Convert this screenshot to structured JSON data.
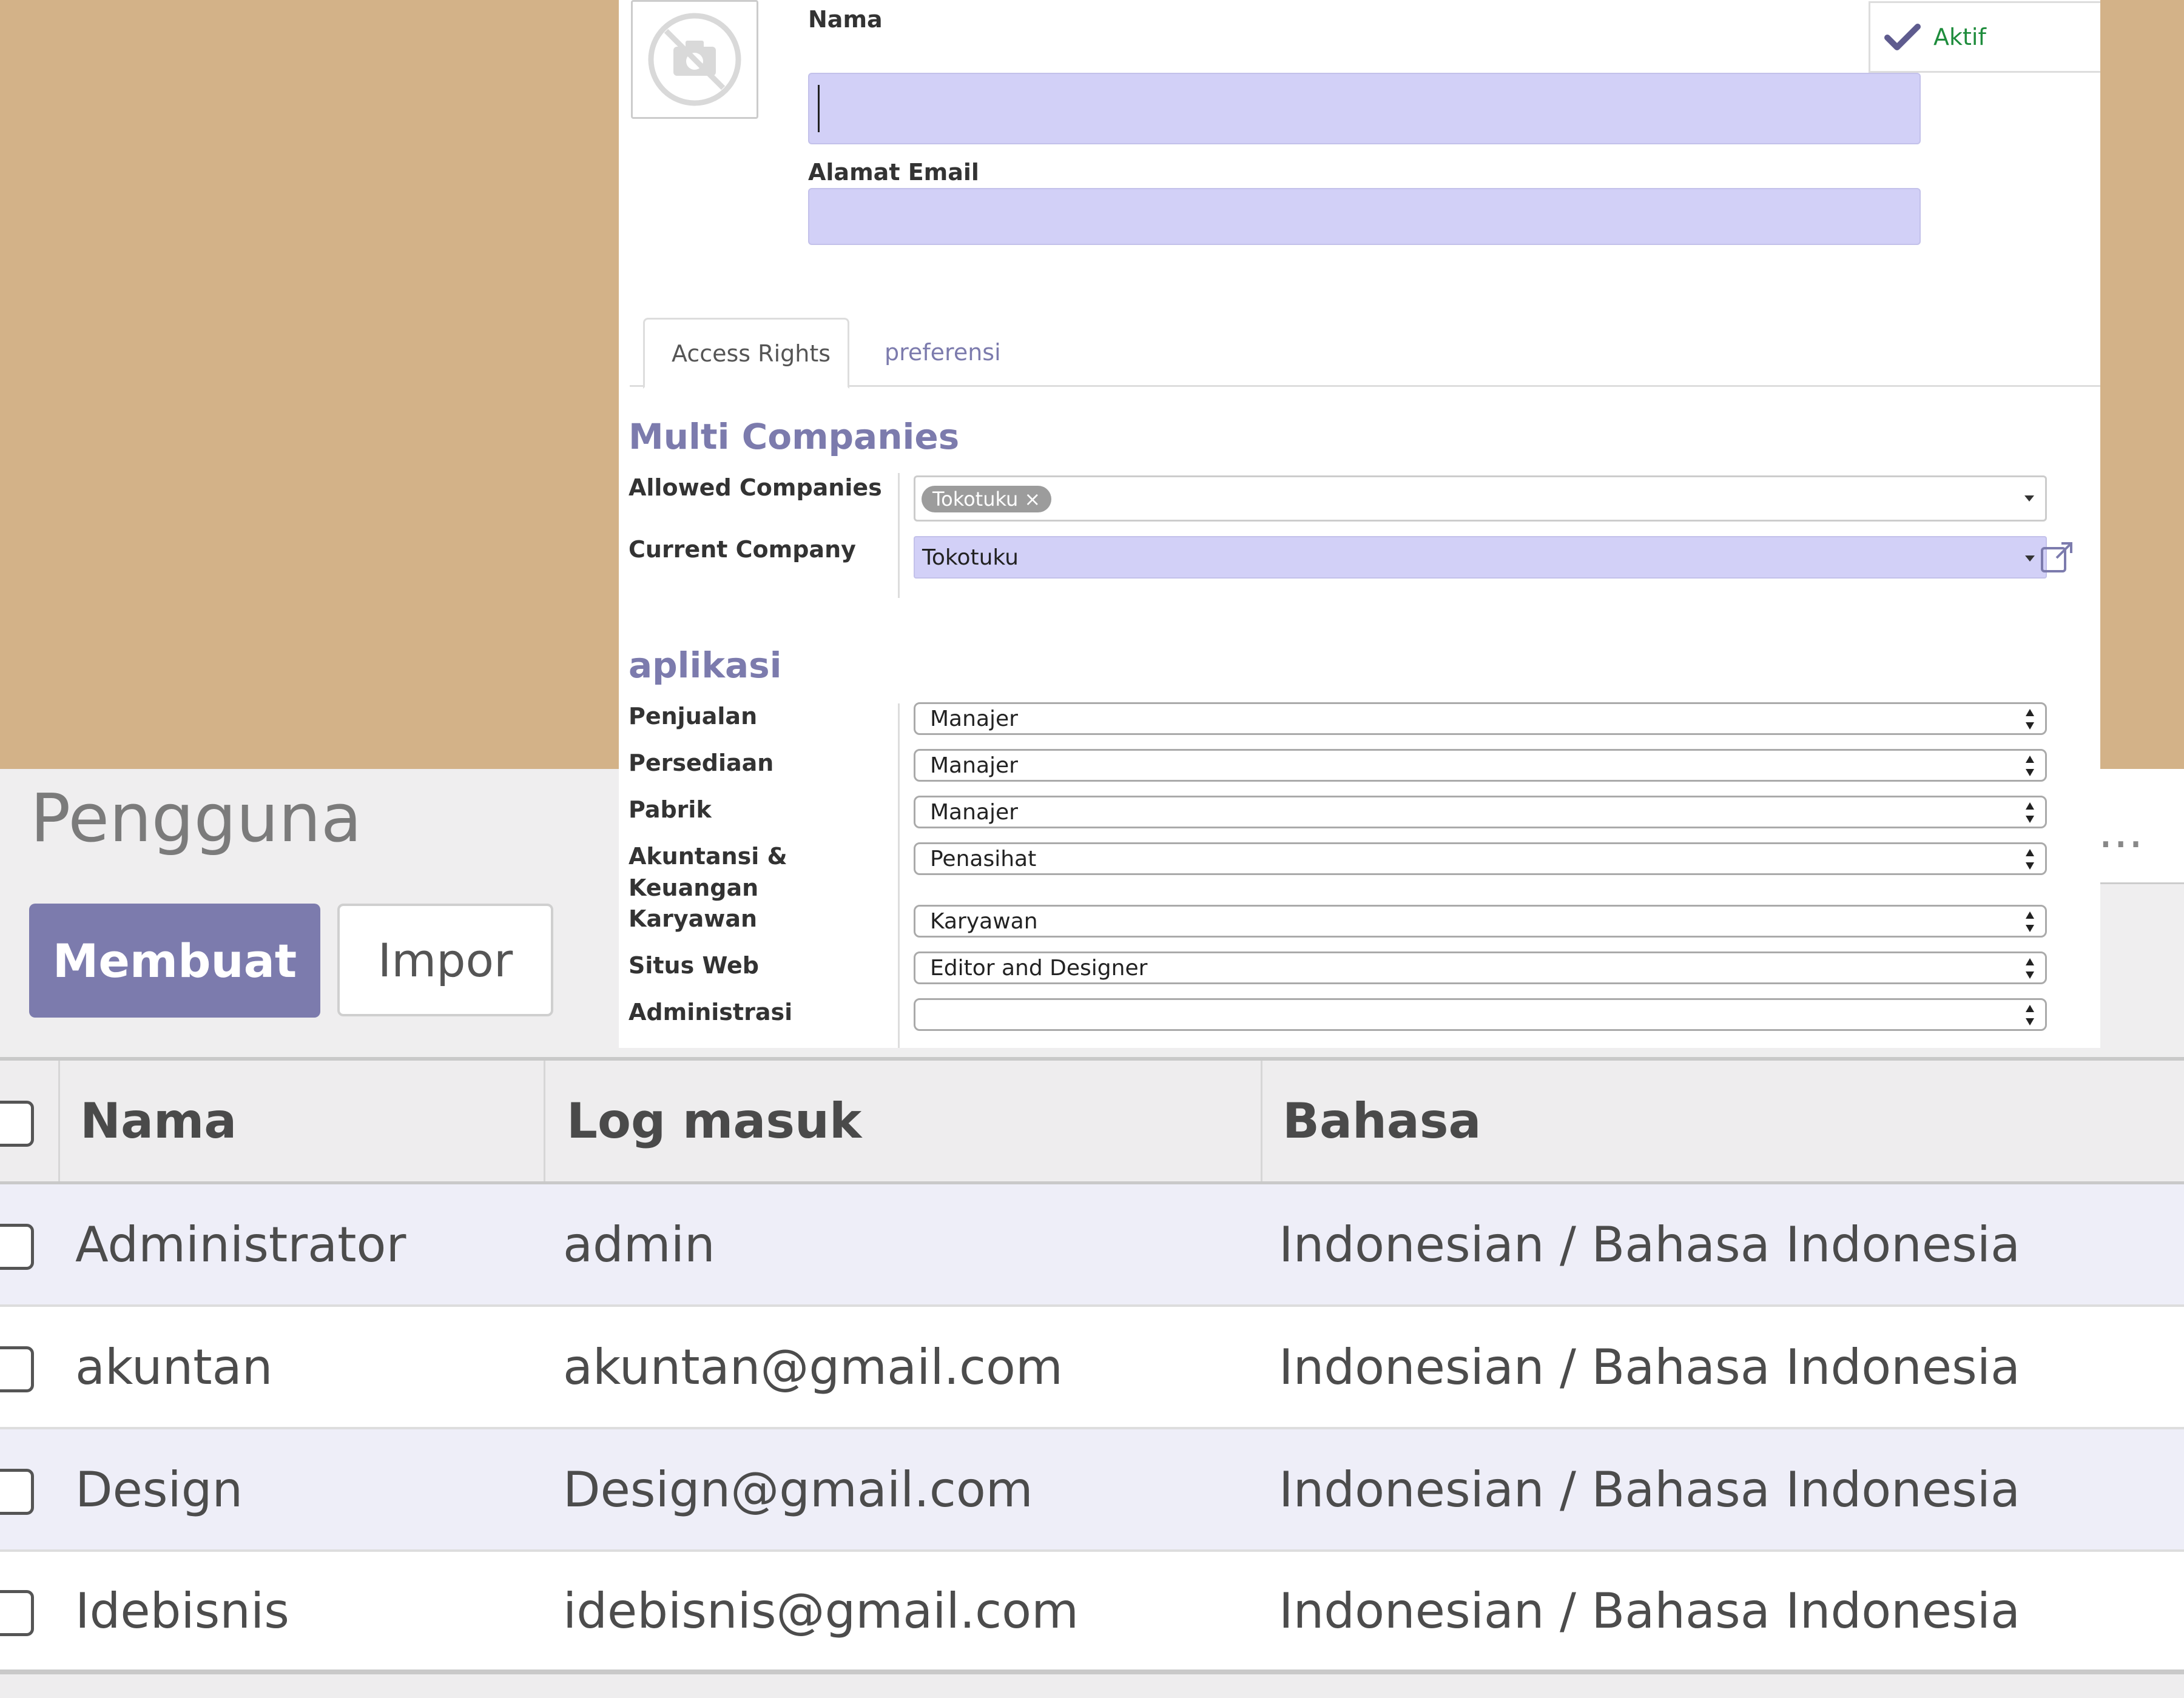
{
  "list_view": {
    "title": "Pengguna",
    "create_label": "Membuat",
    "import_label": "Impor",
    "search_partial": "ri ...",
    "columns": [
      "Nama",
      "Log masuk",
      "Bahasa"
    ],
    "rows": [
      {
        "name": "Administrator",
        "login": "admin",
        "language": "Indonesian / Bahasa Indonesia"
      },
      {
        "name": "akuntan",
        "login": "akuntan@gmail.com",
        "language": "Indonesian / Bahasa Indonesia"
      },
      {
        "name": "Design",
        "login": "Design@gmail.com",
        "language": "Indonesian / Bahasa Indonesia"
      },
      {
        "name": "Idebisnis",
        "login": "idebisnis@gmail.com",
        "language": "Indonesian / Bahasa Indonesia"
      }
    ]
  },
  "form": {
    "name_label": "Nama",
    "name_value": "",
    "email_label": "Alamat Email",
    "email_value": "",
    "active_label": "Aktif",
    "tabs": [
      "Access Rights",
      "preferensi"
    ],
    "multi_companies": {
      "title": "Multi Companies",
      "allowed_label": "Allowed Companies",
      "allowed_tags": [
        "Tokotuku"
      ],
      "current_label": "Current Company",
      "current_value": "Tokotuku"
    },
    "apps": {
      "title": "aplikasi",
      "rows": [
        {
          "label": "Penjualan",
          "value": "Manajer"
        },
        {
          "label": "Persediaan",
          "value": "Manajer"
        },
        {
          "label": "Pabrik",
          "value": "Manajer"
        },
        {
          "label": "Akuntansi & Keuangan",
          "value": "Penasihat"
        },
        {
          "label": "Karyawan",
          "value": "Karyawan"
        },
        {
          "label": "Situs Web",
          "value": "Editor and Designer"
        },
        {
          "label": "Administrasi",
          "value": ""
        }
      ]
    }
  },
  "colors": {
    "accent": "#7c7bad",
    "required_field": "#d2d0f7",
    "background_tan": "#d3b288",
    "active_green": "#1e8c3c"
  }
}
